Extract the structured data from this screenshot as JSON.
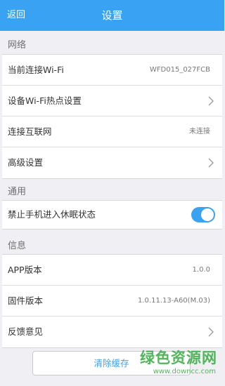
{
  "navbar": {
    "back_label": "返回",
    "title": "设置",
    "color": "#3aa2f3"
  },
  "sections": {
    "network": {
      "header": "网络",
      "items": [
        {
          "label": "当前连接Wi-Fi",
          "value": "WFD015_027FCB"
        },
        {
          "label": "设备Wi-Fi热点设置"
        },
        {
          "label": "连接互联网",
          "value": "未连接"
        },
        {
          "label": "高级设置"
        }
      ]
    },
    "general": {
      "header": "通用",
      "items": [
        {
          "label": "禁止手机进入休眠状态",
          "toggle_on": true
        }
      ]
    },
    "info": {
      "header": "信息",
      "items": [
        {
          "label": "APP版本",
          "value": "1.0.0"
        },
        {
          "label": "固件版本",
          "value": "1.0.11.13-A60(M.03)"
        },
        {
          "label": "反馈意见"
        }
      ]
    }
  },
  "clear_cache_label": "清除缓存",
  "watermark": {
    "text": "绿色资源网",
    "url_text": "www.downcc.com",
    "color": "#3fae49"
  },
  "icons": [
    "chevron-right-icon",
    "toggle-switch"
  ]
}
